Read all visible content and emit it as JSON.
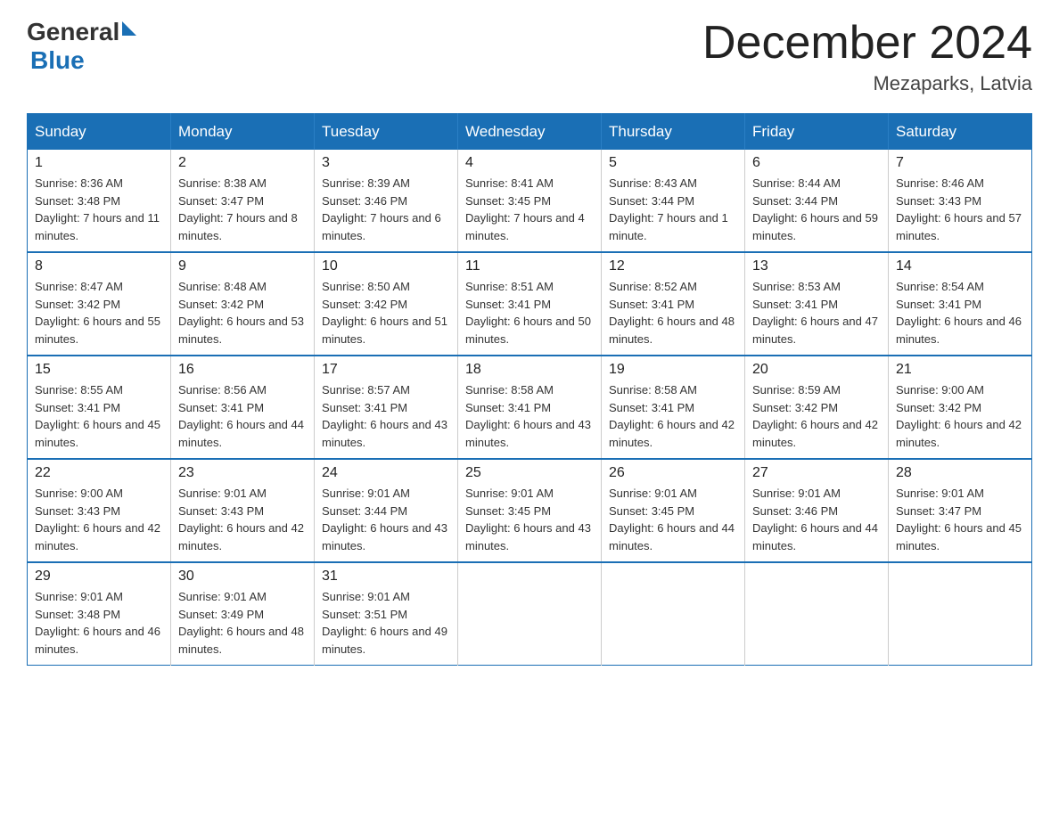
{
  "logo": {
    "general": "General",
    "blue": "Blue",
    "triangle": "▶"
  },
  "header": {
    "month": "December 2024",
    "location": "Mezaparks, Latvia"
  },
  "days_of_week": [
    "Sunday",
    "Monday",
    "Tuesday",
    "Wednesday",
    "Thursday",
    "Friday",
    "Saturday"
  ],
  "weeks": [
    [
      {
        "day": "1",
        "sunrise": "8:36 AM",
        "sunset": "3:48 PM",
        "daylight": "7 hours and 11 minutes."
      },
      {
        "day": "2",
        "sunrise": "8:38 AM",
        "sunset": "3:47 PM",
        "daylight": "7 hours and 8 minutes."
      },
      {
        "day": "3",
        "sunrise": "8:39 AM",
        "sunset": "3:46 PM",
        "daylight": "7 hours and 6 minutes."
      },
      {
        "day": "4",
        "sunrise": "8:41 AM",
        "sunset": "3:45 PM",
        "daylight": "7 hours and 4 minutes."
      },
      {
        "day": "5",
        "sunrise": "8:43 AM",
        "sunset": "3:44 PM",
        "daylight": "7 hours and 1 minute."
      },
      {
        "day": "6",
        "sunrise": "8:44 AM",
        "sunset": "3:44 PM",
        "daylight": "6 hours and 59 minutes."
      },
      {
        "day": "7",
        "sunrise": "8:46 AM",
        "sunset": "3:43 PM",
        "daylight": "6 hours and 57 minutes."
      }
    ],
    [
      {
        "day": "8",
        "sunrise": "8:47 AM",
        "sunset": "3:42 PM",
        "daylight": "6 hours and 55 minutes."
      },
      {
        "day": "9",
        "sunrise": "8:48 AM",
        "sunset": "3:42 PM",
        "daylight": "6 hours and 53 minutes."
      },
      {
        "day": "10",
        "sunrise": "8:50 AM",
        "sunset": "3:42 PM",
        "daylight": "6 hours and 51 minutes."
      },
      {
        "day": "11",
        "sunrise": "8:51 AM",
        "sunset": "3:41 PM",
        "daylight": "6 hours and 50 minutes."
      },
      {
        "day": "12",
        "sunrise": "8:52 AM",
        "sunset": "3:41 PM",
        "daylight": "6 hours and 48 minutes."
      },
      {
        "day": "13",
        "sunrise": "8:53 AM",
        "sunset": "3:41 PM",
        "daylight": "6 hours and 47 minutes."
      },
      {
        "day": "14",
        "sunrise": "8:54 AM",
        "sunset": "3:41 PM",
        "daylight": "6 hours and 46 minutes."
      }
    ],
    [
      {
        "day": "15",
        "sunrise": "8:55 AM",
        "sunset": "3:41 PM",
        "daylight": "6 hours and 45 minutes."
      },
      {
        "day": "16",
        "sunrise": "8:56 AM",
        "sunset": "3:41 PM",
        "daylight": "6 hours and 44 minutes."
      },
      {
        "day": "17",
        "sunrise": "8:57 AM",
        "sunset": "3:41 PM",
        "daylight": "6 hours and 43 minutes."
      },
      {
        "day": "18",
        "sunrise": "8:58 AM",
        "sunset": "3:41 PM",
        "daylight": "6 hours and 43 minutes."
      },
      {
        "day": "19",
        "sunrise": "8:58 AM",
        "sunset": "3:41 PM",
        "daylight": "6 hours and 42 minutes."
      },
      {
        "day": "20",
        "sunrise": "8:59 AM",
        "sunset": "3:42 PM",
        "daylight": "6 hours and 42 minutes."
      },
      {
        "day": "21",
        "sunrise": "9:00 AM",
        "sunset": "3:42 PM",
        "daylight": "6 hours and 42 minutes."
      }
    ],
    [
      {
        "day": "22",
        "sunrise": "9:00 AM",
        "sunset": "3:43 PM",
        "daylight": "6 hours and 42 minutes."
      },
      {
        "day": "23",
        "sunrise": "9:01 AM",
        "sunset": "3:43 PM",
        "daylight": "6 hours and 42 minutes."
      },
      {
        "day": "24",
        "sunrise": "9:01 AM",
        "sunset": "3:44 PM",
        "daylight": "6 hours and 43 minutes."
      },
      {
        "day": "25",
        "sunrise": "9:01 AM",
        "sunset": "3:45 PM",
        "daylight": "6 hours and 43 minutes."
      },
      {
        "day": "26",
        "sunrise": "9:01 AM",
        "sunset": "3:45 PM",
        "daylight": "6 hours and 44 minutes."
      },
      {
        "day": "27",
        "sunrise": "9:01 AM",
        "sunset": "3:46 PM",
        "daylight": "6 hours and 44 minutes."
      },
      {
        "day": "28",
        "sunrise": "9:01 AM",
        "sunset": "3:47 PM",
        "daylight": "6 hours and 45 minutes."
      }
    ],
    [
      {
        "day": "29",
        "sunrise": "9:01 AM",
        "sunset": "3:48 PM",
        "daylight": "6 hours and 46 minutes."
      },
      {
        "day": "30",
        "sunrise": "9:01 AM",
        "sunset": "3:49 PM",
        "daylight": "6 hours and 48 minutes."
      },
      {
        "day": "31",
        "sunrise": "9:01 AM",
        "sunset": "3:51 PM",
        "daylight": "6 hours and 49 minutes."
      },
      null,
      null,
      null,
      null
    ]
  ]
}
